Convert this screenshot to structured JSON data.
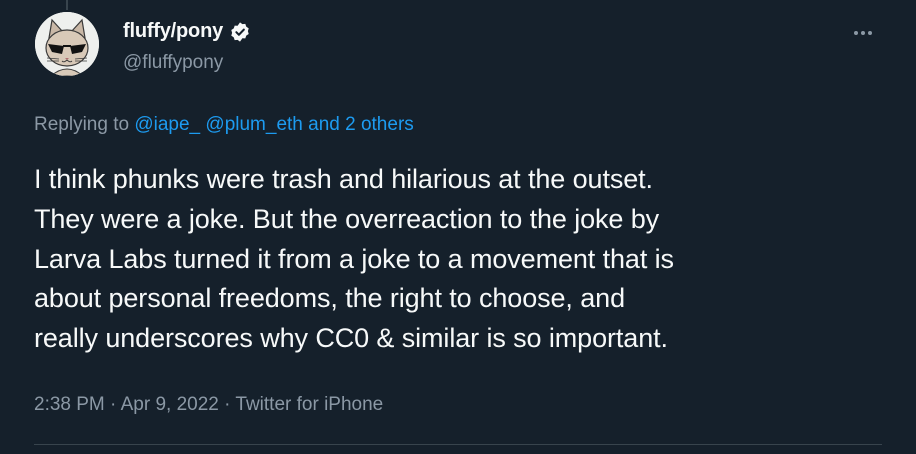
{
  "tweet": {
    "display_name": "fluffy/pony",
    "handle": "@fluffypony",
    "verified": true,
    "replying_prefix": "Replying to",
    "reply_mentions": [
      "@iape_",
      "@plum_eth"
    ],
    "reply_others": "and 2 others",
    "text": "I think phunks were trash and hilarious at the outset.\nThey were a joke. But the overreaction to the joke by\nLarva Labs turned it from a joke to a movement that is\nabout personal freedoms, the right to choose, and\nreally underscores why CC0 & similar is so important.",
    "time": "2:38 PM",
    "separator": "·",
    "date": "Apr 9, 2022",
    "source": "Twitter for iPhone"
  },
  "colors": {
    "background": "#15202b",
    "text": "#f7f9f9",
    "muted": "#8b98a5",
    "accent": "#1d9bf0",
    "divider": "#38444d"
  },
  "icons": {
    "verified": "verified-badge-icon",
    "more": "more-options-icon"
  }
}
